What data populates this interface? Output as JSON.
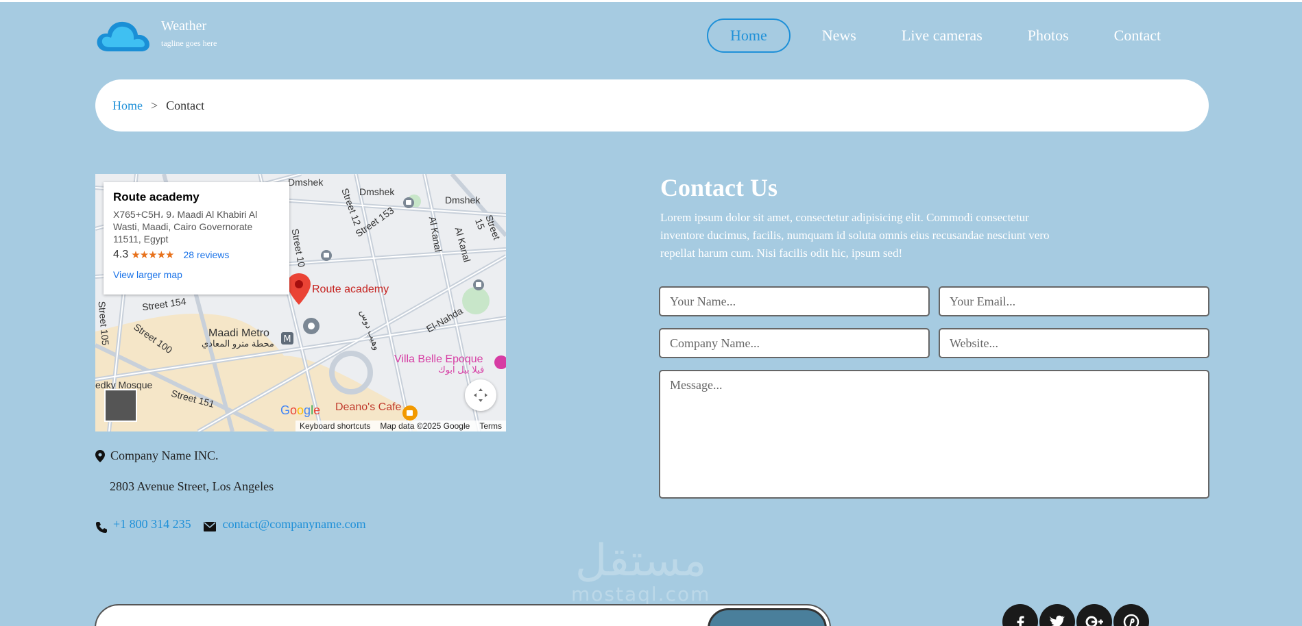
{
  "header": {
    "brand_name": "Weather",
    "tagline": "tagline goes here",
    "nav": [
      {
        "label": "Home",
        "active": true
      },
      {
        "label": "News",
        "active": false
      },
      {
        "label": "Live cameras",
        "active": false
      },
      {
        "label": "Photos",
        "active": false
      },
      {
        "label": "Contact",
        "active": false
      }
    ]
  },
  "breadcrumb": {
    "home": "Home",
    "separator": ">",
    "current": "Contact"
  },
  "map": {
    "place_name": "Route academy",
    "address": "X765+C5H، 9، Maadi Al Khabiri Al Wasti, Maadi, Cairo Governorate 11511, Egypt",
    "rating": "4.3",
    "stars": "★★★★★",
    "reviews": "28 reviews",
    "larger_map": "View larger map",
    "pin_label": "Route academy",
    "labels": {
      "dmshek1": "Dmshek",
      "dmshek2": "Dmshek",
      "dmshek3": "Dmshek",
      "street12": "Street 12",
      "street153": "Street 153",
      "street15": "Street 15",
      "street10": "Street 10",
      "street105": "Street 105",
      "street154": "Street 154",
      "street100": "Street 100",
      "street151": "Street 151",
      "alkanal1": "Al Kanal",
      "alkanal2": "Al Kanal",
      "elnahda": "El-Nahda",
      "maadi_metro": "Maadi Metro",
      "maadi_metro_ar": "محطة مترو المعادي",
      "villa": "Villa Belle Epoque",
      "villa_ar": "فيلا بيل ابوك",
      "deano": "Deano's Cafe",
      "mosque": "edky Mosque",
      "arabic_street": "وهيب دوس"
    },
    "footer": {
      "shortcuts": "Keyboard shortcuts",
      "map_data": "Map data ©2025 Google",
      "terms": "Terms"
    },
    "google_logo": "Google"
  },
  "contact_info": {
    "company": "Company Name INC.",
    "address": "2803 Avenue Street, Los Angeles",
    "phone": "+1 800 314 235",
    "email": "contact@companyname.com"
  },
  "contact_form": {
    "title": "Contact Us",
    "description": "Lorem ipsum dolor sit amet, consectetur adipisicing elit. Commodi consectetur inventore ducimus, facilis, numquam id soluta omnis eius recusandae nesciunt vero repellat harum cum. Nisi facilis odit hic, ipsum sed!",
    "name_placeholder": "Your Name...",
    "email_placeholder": "Your Email...",
    "company_placeholder": "Company Name...",
    "website_placeholder": "Website...",
    "message_placeholder": "Message..."
  },
  "social": [
    "facebook-icon",
    "twitter-icon",
    "google-plus-icon",
    "pinterest-icon"
  ],
  "watermark": {
    "arabic": "مستقل",
    "latin": "mostaql.com"
  },
  "colors": {
    "background": "#a6cbe1",
    "accent": "#1e90d8",
    "newsletter_button": "#4a7f9b"
  }
}
